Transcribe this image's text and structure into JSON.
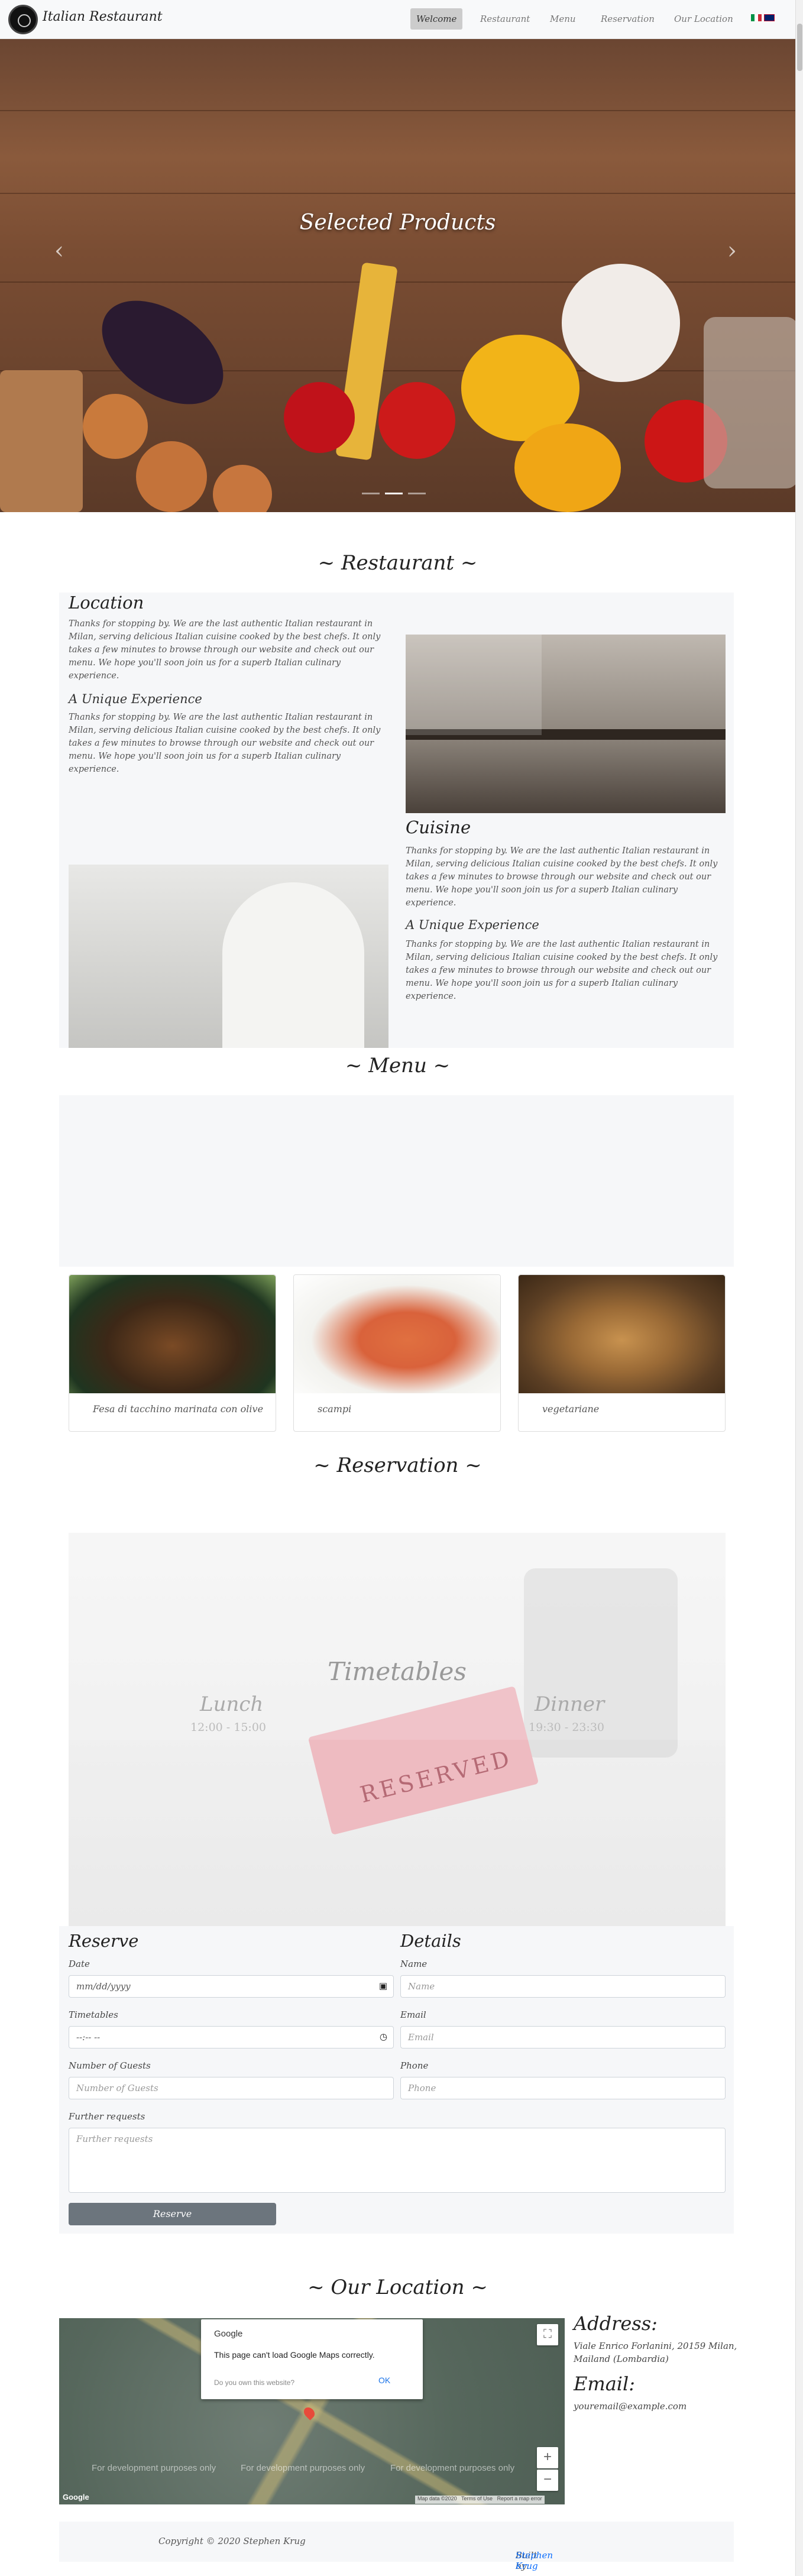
{
  "nav": {
    "brand": "Italian Restaurant",
    "items": [
      "Welcome",
      "Restaurant",
      "Menu",
      "Reservation",
      "Our Location"
    ]
  },
  "hero": {
    "caption": "Selected Products",
    "slides": 3,
    "active_slide": 2,
    "prev_icon": "chevron-left-icon",
    "next_icon": "chevron-right-icon"
  },
  "restaurant": {
    "title": "~ Restaurant ~",
    "location_heading": "Location",
    "location_text": "Thanks for stopping by. We are the last authentic Italian restaurant in Milan, serving delicious Italian cuisine cooked by the best chefs. It only takes a few minutes to browse through our website and check out our menu. We hope you'll soon join us for a superb Italian culinary experience.",
    "unique_heading_1": "A Unique Experience",
    "unique_text_1": "Thanks for stopping by. We are the last authentic Italian restaurant in Milan, serving delicious Italian cuisine cooked by the best chefs. It only takes a few minutes to browse through our website and check out our menu. We hope you'll soon join us for a superb Italian culinary experience.",
    "cuisine_heading": "Cuisine",
    "cuisine_text": "Thanks for stopping by. We are the last authentic Italian restaurant in Milan, serving delicious Italian cuisine cooked by the best chefs. It only takes a few minutes to browse through our website and check out our menu. We hope you'll soon join us for a superb Italian culinary experience.",
    "unique_heading_2": "A Unique Experience",
    "unique_text_2": "Thanks for stopping by. We are the last authentic Italian restaurant in Milan, serving delicious Italian cuisine cooked by the best chefs. It only takes a few minutes to browse through our website and check out our menu. We hope you'll soon join us for a superb Italian culinary experience."
  },
  "menu": {
    "title": "~ Menu ~",
    "cards": [
      {
        "caption": "Fesa di tacchino marinata con olive"
      },
      {
        "caption": "scampi"
      },
      {
        "caption": "vegetariane"
      }
    ]
  },
  "reservation": {
    "title": "~ Reservation ~",
    "timetables_heading": "Timetables",
    "lunch_label": "Lunch",
    "lunch_hours": "12:00 - 15:00",
    "dinner_label": "Dinner",
    "dinner_hours": "19:30 - 23:30",
    "sign_text": "RESERVED",
    "reserve_heading": "Reserve",
    "details_heading": "Details",
    "date_label": "Date",
    "date_placeholder": "mm/dd/yyyy",
    "timetables_label": "Timetables",
    "time_placeholder": "--:-- --",
    "guests_label": "Number of Guests",
    "guests_placeholder": "Number of Guests",
    "requests_label": "Further requests",
    "requests_placeholder": "Further requests",
    "name_label": "Name",
    "name_placeholder": "Name",
    "email_label": "Email",
    "email_placeholder": "Email",
    "phone_label": "Phone",
    "phone_placeholder": "Phone",
    "submit_label": "Reserve"
  },
  "location": {
    "title": "~ Our Location ~",
    "address_heading": "Address:",
    "address_line1": "Viale Enrico Forlanini, 20159 Milan,",
    "address_line2": "Mailand (Lombardia)",
    "email_heading": "Email:",
    "email_value": "youremail@example.com",
    "map": {
      "dialog_brand": "Google",
      "dialog_message": "This page can't load Google Maps correctly.",
      "dialog_link": "Do you own this website?",
      "dialog_ok": "OK",
      "dev_text": "For development purposes only",
      "zoom_in": "+",
      "zoom_out": "−",
      "footer_logo": "Google",
      "map_data": "Map data ©2020",
      "terms": "Terms of Use",
      "report": "Report a map error"
    }
  },
  "footer": {
    "copyright": "Copyright © 2020 Stephen Krug",
    "built_prefix": "Built by: ",
    "built_link": "Stephen Krug"
  },
  "colors": {
    "link": "#0d6efd",
    "button": "#6c757d",
    "panel": "#f6f7f9"
  }
}
